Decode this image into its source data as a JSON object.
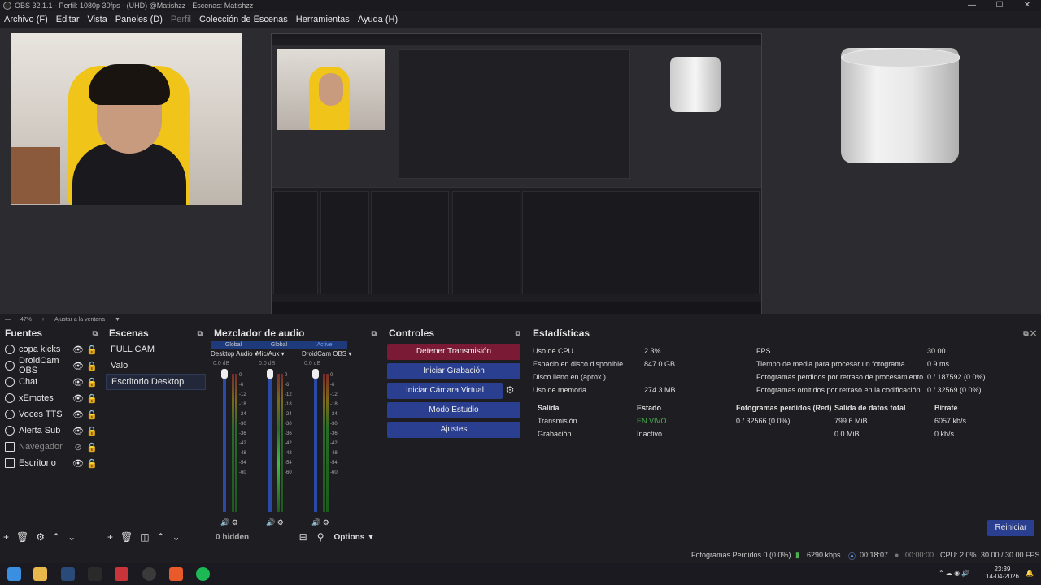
{
  "titlebar": {
    "title": "OBS 32.1.1 - Perfil: 1080p 30fps - (UHD) @Matishzz - Escenas: Matishzz",
    "min": "—",
    "max": "☐",
    "close": "✕"
  },
  "menu": [
    "Archivo (F)",
    "Editar",
    "Vista",
    "Paneles (D)",
    "Perfil",
    "Colección de Escenas",
    "Herramientas",
    "Ayuda (H)"
  ],
  "zoom": {
    "value": "47%",
    "fit": "Ajustar a la ventana"
  },
  "sources": {
    "title": "Fuentes",
    "items": [
      {
        "name": "copa kicks",
        "icon": "camera-icon"
      },
      {
        "name": "DroidCam OBS",
        "icon": "camera-icon"
      },
      {
        "name": "Chat",
        "icon": "globe-icon"
      },
      {
        "name": "xEmotes",
        "icon": "globe-icon"
      },
      {
        "name": "Voces TTS",
        "icon": "globe-icon"
      },
      {
        "name": "Alerta Sub",
        "icon": "globe-icon"
      },
      {
        "name": "Navegador",
        "icon": "monitor-icon",
        "hidden": true
      },
      {
        "name": "Escritorio",
        "icon": "monitor-icon"
      }
    ]
  },
  "scenes": {
    "title": "Escenas",
    "items": [
      "FULL CAM",
      "Valo",
      "Escritorio Desktop"
    ],
    "active": 2
  },
  "mixer": {
    "title": "Mezclador de audio",
    "channels": [
      {
        "tag": "Global",
        "name": "Desktop Audio",
        "db": "0.0 dB"
      },
      {
        "tag": "Global",
        "name": "Mic/Aux",
        "db": "0.0 dB"
      },
      {
        "tag": "Active",
        "name": "DroidCam OBS",
        "db": "0.0 dB"
      }
    ],
    "scale": [
      "0",
      "-6",
      "-12",
      "-18",
      "-24",
      "-30",
      "-36",
      "-42",
      "-48",
      "-54",
      "-60"
    ],
    "hidden": "0 hidden",
    "options": "Options"
  },
  "controls": {
    "title": "Controles",
    "stop": "Detener Transmisión",
    "record": "Iniciar Grabación",
    "vcam": "Iniciar Cámara Virtual",
    "studio": "Modo Estudio",
    "settings": "Ajustes"
  },
  "stats": {
    "title": "Estadísticas",
    "left": [
      {
        "label": "Uso de CPU",
        "value": "2.3%"
      },
      {
        "label": "Espacio en disco disponible",
        "value": "847.0 GB"
      },
      {
        "label": "Disco lleno en (aprox.)",
        "value": ""
      },
      {
        "label": "Uso de memoria",
        "value": "274.3 MB"
      }
    ],
    "right": [
      {
        "label": "FPS",
        "value": "30.00"
      },
      {
        "label": "Tiempo de media para procesar un fotograma",
        "value": "0.9 ms"
      },
      {
        "label": "Fotogramas perdidos por retraso de procesamiento",
        "value": "0 / 187592 (0.0%)"
      },
      {
        "label": "Fotogramas omitidos por retraso en la codificación",
        "value": "0 / 32569 (0.0%)"
      }
    ],
    "table_headers": [
      "Salida",
      "Estado",
      "Fotogramas perdidos (Red)",
      "Salida de datos total",
      "Bitrate"
    ],
    "table_rows": [
      [
        "Transmisión",
        "EN VIVO",
        "0 / 32566 (0.0%)",
        "799.6 MiB",
        "6057 kb/s"
      ],
      [
        "Grabación",
        "Inactivo",
        "",
        "0.0 MiB",
        "0 kb/s"
      ]
    ],
    "reset": "Reiniciar"
  },
  "statusbar": {
    "dropped": "Fotogramas Perdidos 0 (0.0%)",
    "kbps": "6290 kbps",
    "live_time": "00:18:07",
    "rec_time": "00:00:00",
    "cpu": "CPU: 2.0%",
    "fps": "30.00 / 30.00 FPS"
  },
  "taskbar": {
    "time": "23:39",
    "date": "14-04-2026"
  },
  "colors": {
    "accent": "#2a3f8f",
    "stop": "#7a1a35",
    "live": "#4caf50"
  }
}
